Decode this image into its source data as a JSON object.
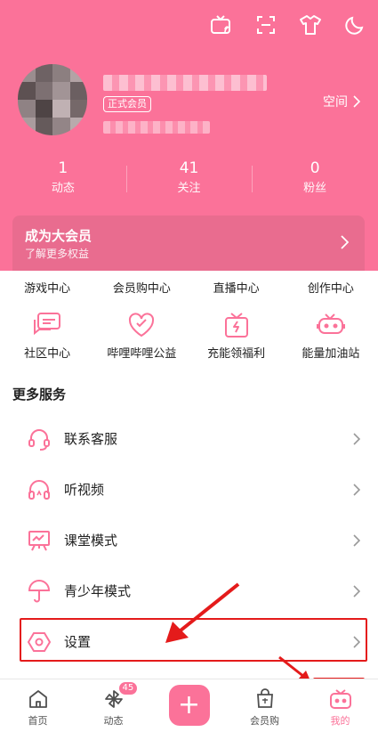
{
  "colors": {
    "brand": "#fb7299",
    "highlight": "#e41b1b"
  },
  "header": {
    "top_icons": [
      "tv-cast-icon",
      "scan-icon",
      "tshirt-icon",
      "moon-icon"
    ],
    "badge": "正式会员",
    "space_link": "空间"
  },
  "stats": [
    {
      "value": "1",
      "label": "动态"
    },
    {
      "value": "41",
      "label": "关注"
    },
    {
      "value": "0",
      "label": "粉丝"
    }
  ],
  "vip": {
    "title": "成为大会员",
    "subtitle": "了解更多权益"
  },
  "grid_row1": [
    "游戏中心",
    "会员购中心",
    "直播中心",
    "创作中心"
  ],
  "grid_row2": [
    {
      "label": "社区中心",
      "icon": "chat-icon"
    },
    {
      "label": "哔哩哔哩公益",
      "icon": "heart-icon"
    },
    {
      "label": "充能领福利",
      "icon": "gift-icon"
    },
    {
      "label": "能量加油站",
      "icon": "energy-tv-icon"
    }
  ],
  "more_services": {
    "title": "更多服务",
    "items": [
      {
        "label": "联系客服",
        "icon": "headset-icon"
      },
      {
        "label": "听视频",
        "icon": "headphones-icon"
      },
      {
        "label": "课堂模式",
        "icon": "classroom-icon"
      },
      {
        "label": "青少年模式",
        "icon": "umbrella-icon"
      },
      {
        "label": "设置",
        "icon": "settings-hex-icon"
      }
    ]
  },
  "tabbar": {
    "home": "首页",
    "dynamic": "动态",
    "dynamic_badge": "45",
    "plus": "+",
    "shop": "会员购",
    "mine": "我的"
  }
}
